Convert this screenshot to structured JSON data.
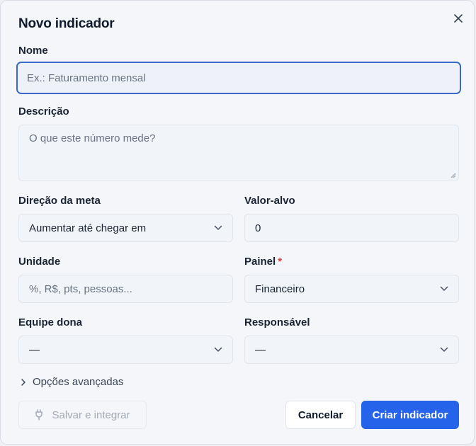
{
  "dialog": {
    "title": "Novo indicador"
  },
  "form": {
    "name": {
      "label": "Nome",
      "placeholder": "Ex.: Faturamento mensal"
    },
    "description": {
      "label": "Descrição",
      "placeholder": "O que este número mede?"
    },
    "goal_direction": {
      "label": "Direção da meta",
      "value": "Aumentar até chegar em"
    },
    "target_value": {
      "label": "Valor-alvo",
      "value": "0"
    },
    "unit": {
      "label": "Unidade",
      "placeholder": "%, R$, pts, pessoas..."
    },
    "panel": {
      "label": "Painel",
      "required_mark": "*",
      "value": "Financeiro"
    },
    "owner_team": {
      "label": "Equipe dona",
      "value": "—"
    },
    "responsible": {
      "label": "Responsável",
      "value": "—"
    }
  },
  "advanced": {
    "label": "Opções avançadas"
  },
  "actions": {
    "save_integrate": "Salvar e integrar",
    "cancel": "Cancelar",
    "create": "Criar indicador"
  },
  "colors": {
    "primary": "#2563eb",
    "focus_border": "#3b69c9",
    "required": "#e23b3b"
  }
}
